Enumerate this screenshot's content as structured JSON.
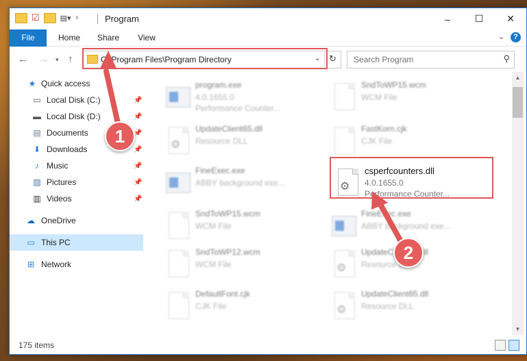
{
  "window": {
    "title": "Program",
    "controls": {
      "minimize": "–",
      "maximize": "☐",
      "close": "✕"
    }
  },
  "ribbon": {
    "tabs": [
      {
        "label": "File"
      },
      {
        "label": "Home"
      },
      {
        "label": "Share"
      },
      {
        "label": "View"
      }
    ],
    "help": "?"
  },
  "navigation": {
    "address": "C:\\Program Files\\Program Directory",
    "search_placeholder": "Search Program"
  },
  "sidebar": {
    "items": [
      {
        "label": "Quick access",
        "icon": "star-icon",
        "pinned": false
      },
      {
        "label": "Local Disk (C:)",
        "icon": "drive-icon",
        "pinned": true
      },
      {
        "label": "Local Disk (D:)",
        "icon": "drive-icon",
        "pinned": true
      },
      {
        "label": "Documents",
        "icon": "documents-icon",
        "pinned": true
      },
      {
        "label": "Downloads",
        "icon": "download-icon",
        "pinned": true
      },
      {
        "label": "Music",
        "icon": "music-icon",
        "pinned": true
      },
      {
        "label": "Pictures",
        "icon": "pictures-icon",
        "pinned": true
      },
      {
        "label": "Videos",
        "icon": "video-icon",
        "pinned": true
      },
      {
        "label": "OneDrive",
        "icon": "cloud-icon",
        "pinned": false
      },
      {
        "label": "This PC",
        "icon": "computer-icon",
        "pinned": false,
        "selected": true
      },
      {
        "label": "Network",
        "icon": "network-icon",
        "pinned": false
      }
    ]
  },
  "files": [
    {
      "name": "program.exe",
      "line2": "4.0.1655.0",
      "line3": "Performance Counter...",
      "icon": "program-exe-icon",
      "faded": true
    },
    {
      "name": "SndToWP15.wcm",
      "line2": "WCM File",
      "line3": "",
      "icon": "file-icon",
      "faded": true
    },
    {
      "name": "UpdateClient65.dll",
      "line2": "Resource DLL",
      "line3": "",
      "icon": "dll-gear-icon",
      "faded": true
    },
    {
      "name": "FastKorn.cjk",
      "line2": "CJK File",
      "line3": "",
      "icon": "file-icon",
      "faded": true
    },
    {
      "name": "FineExec.exe",
      "line2": "ABBY background exe...",
      "line3": "",
      "icon": "exe-window-icon",
      "faded": true
    },
    {
      "name": "csperfcounters.dll",
      "line2": "4.0.1655.0",
      "line3": "Performance Counter...",
      "icon": "dll-gear-icon",
      "faded": false
    },
    {
      "name": "SndToWP15.wcm",
      "line2": "WCM File",
      "line3": "",
      "icon": "file-icon",
      "faded": true
    },
    {
      "name": "FineExec.exe",
      "line2": "ABBY background exe...",
      "line3": "",
      "icon": "exe-window-icon",
      "faded": true
    },
    {
      "name": "SndToWP12.wcm",
      "line2": "WCM File",
      "line3": "",
      "icon": "file-icon",
      "faded": true
    },
    {
      "name": "UpdateClient65.dll",
      "line2": "Resource DLL",
      "line3": "",
      "icon": "dll-gear-icon",
      "faded": true
    },
    {
      "name": "DefaultFont.cjk",
      "line2": "CJK File",
      "line3": "",
      "icon": "file-icon",
      "faded": true
    },
    {
      "name": "UpdateClient65.dll",
      "line2": "Resource DLL",
      "line3": "",
      "icon": "dll-gear-icon",
      "faded": true
    }
  ],
  "status": {
    "item_count": "175 items"
  },
  "annotations": {
    "badge1": "1",
    "badge2": "2",
    "color": "#e05757"
  }
}
